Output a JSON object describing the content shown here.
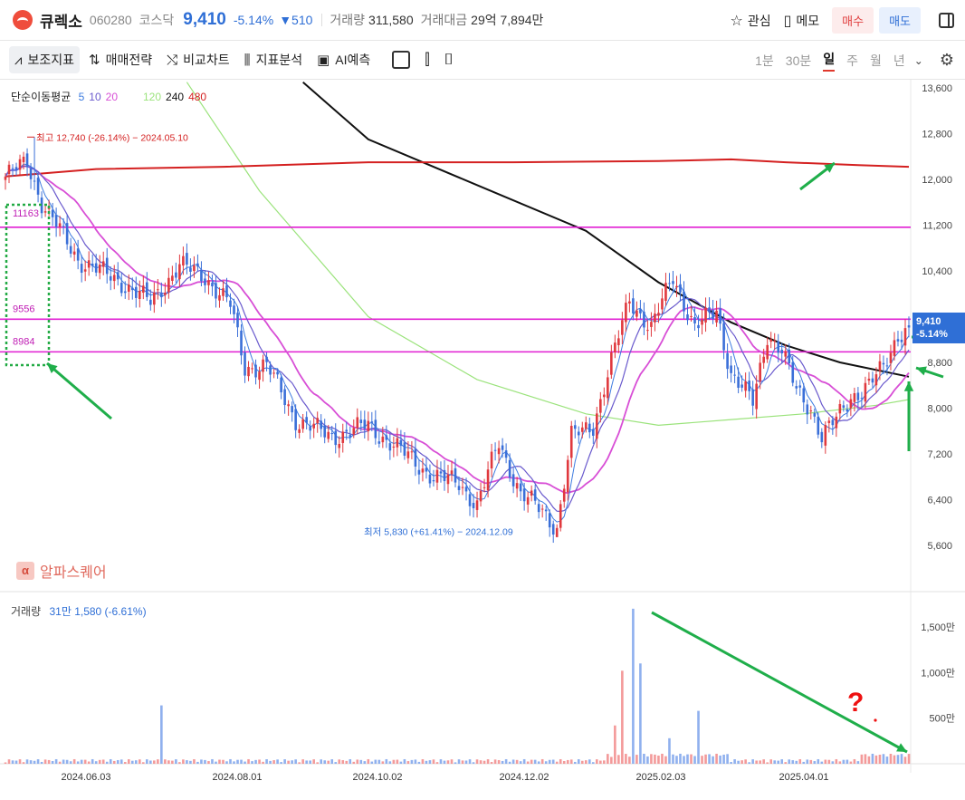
{
  "header": {
    "name": "큐렉소",
    "code": "060280",
    "market": "코스닥",
    "price": "9,410",
    "change_pct": "-5.14%",
    "change_abs": "▼510",
    "volume_label": "거래량",
    "volume": "311,580",
    "amount_label": "거래대금",
    "amount": "29억 7,894만",
    "watch": "관심",
    "memo": "메모",
    "buy": "매수",
    "sell": "매도"
  },
  "toolbar": {
    "indicators": "보조지표",
    "strategy": "매매전략",
    "compare": "비교차트",
    "analysis": "지표분석",
    "ai": "AI예측",
    "periods": [
      "1분",
      "30분",
      "일",
      "주",
      "월",
      "년"
    ],
    "selected_period": "일"
  },
  "ma_legend": {
    "label": "단순이동평균",
    "items": [
      {
        "text": "5",
        "color": "#3d7be0"
      },
      {
        "text": "10",
        "color": "#6a5acd"
      },
      {
        "text": "20",
        "color": "#d84fd6"
      },
      {
        "text": "120",
        "color": "#9be37c"
      },
      {
        "text": "240",
        "color": "#111111"
      },
      {
        "text": "480",
        "color": "#d42020"
      }
    ]
  },
  "brand": "알파스퀘어",
  "price_tag": {
    "price": "9,410",
    "pct": "-5.14%"
  },
  "volume_legend": {
    "label": "거래량",
    "value": "31만 1,580 (-6.61%)"
  },
  "annotations": {
    "high": "최고 12,740 (-26.14%) − 2024.05.10",
    "low": "최저 5,830 (+61.41%) − 2024.12.09",
    "levels": [
      "11163",
      "9556",
      "8984"
    ],
    "question": "?"
  },
  "chart_data": {
    "type": "candlestick",
    "y_axis": {
      "ticks": [
        13600,
        12800,
        12000,
        11200,
        10400,
        9600,
        8800,
        8000,
        7200,
        6400,
        5600
      ],
      "range": [
        5200,
        13900
      ]
    },
    "volume_axis": {
      "ticks": [
        "1,500만",
        "1,000만",
        "500만"
      ]
    },
    "x_labels": [
      "2024.06.03",
      "2024.08.01",
      "2024.10.02",
      "2024.12.02",
      "2025.02.03",
      "2025.04.01"
    ],
    "horizontal_levels": [
      11163,
      9556,
      8984
    ],
    "high": 12740,
    "low": 5830,
    "last": 9410,
    "anchors": [
      {
        "i": 0,
        "v": 12050
      },
      {
        "i": 6,
        "v": 12300
      },
      {
        "i": 10,
        "v": 11600
      },
      {
        "i": 20,
        "v": 10600
      },
      {
        "i": 32,
        "v": 10200
      },
      {
        "i": 40,
        "v": 9850
      },
      {
        "i": 48,
        "v": 10500
      },
      {
        "i": 55,
        "v": 10300
      },
      {
        "i": 62,
        "v": 9800
      },
      {
        "i": 66,
        "v": 8700
      },
      {
        "i": 72,
        "v": 8750
      },
      {
        "i": 80,
        "v": 7800
      },
      {
        "i": 90,
        "v": 7500
      },
      {
        "i": 100,
        "v": 7700
      },
      {
        "i": 110,
        "v": 7200
      },
      {
        "i": 118,
        "v": 6800
      },
      {
        "i": 125,
        "v": 6700
      },
      {
        "i": 130,
        "v": 6300
      },
      {
        "i": 136,
        "v": 7400
      },
      {
        "i": 142,
        "v": 6500
      },
      {
        "i": 148,
        "v": 6200
      },
      {
        "i": 152,
        "v": 5900
      },
      {
        "i": 156,
        "v": 7500
      },
      {
        "i": 162,
        "v": 7700
      },
      {
        "i": 166,
        "v": 8600
      },
      {
        "i": 172,
        "v": 9900
      },
      {
        "i": 178,
        "v": 9400
      },
      {
        "i": 184,
        "v": 10300
      },
      {
        "i": 190,
        "v": 9400
      },
      {
        "i": 196,
        "v": 9700
      },
      {
        "i": 200,
        "v": 8600
      },
      {
        "i": 206,
        "v": 8100
      },
      {
        "i": 210,
        "v": 9300
      },
      {
        "i": 214,
        "v": 9000
      },
      {
        "i": 218,
        "v": 8300
      },
      {
        "i": 222,
        "v": 8000
      },
      {
        "i": 225,
        "v": 7500
      },
      {
        "i": 229,
        "v": 7800
      },
      {
        "i": 233,
        "v": 8200
      },
      {
        "i": 238,
        "v": 8400
      },
      {
        "i": 242,
        "v": 8700
      },
      {
        "i": 246,
        "v": 9300
      },
      {
        "i": 249,
        "v": 9410
      }
    ],
    "ma_lines": {
      "ma480": [
        [
          0,
          12050
        ],
        [
          25,
          12180
        ],
        [
          60,
          12220
        ],
        [
          100,
          12300
        ],
        [
          140,
          12300
        ],
        [
          180,
          12320
        ],
        [
          200,
          12350
        ],
        [
          215,
          12300
        ],
        [
          235,
          12250
        ],
        [
          249,
          12220
        ]
      ],
      "ma240": [
        [
          82,
          13700
        ],
        [
          100,
          12700
        ],
        [
          130,
          11900
        ],
        [
          160,
          11100
        ],
        [
          180,
          10200
        ],
        [
          200,
          9500
        ],
        [
          215,
          9100
        ],
        [
          230,
          8800
        ],
        [
          249,
          8550
        ]
      ],
      "ma120": [
        [
          50,
          13700
        ],
        [
          70,
          11800
        ],
        [
          100,
          9600
        ],
        [
          130,
          8500
        ],
        [
          160,
          7900
        ],
        [
          180,
          7700
        ],
        [
          200,
          7800
        ],
        [
          220,
          7900
        ],
        [
          240,
          8050
        ],
        [
          249,
          8150
        ]
      ]
    },
    "volume_spikes": [
      {
        "i": 43,
        "v": 640
      },
      {
        "i": 170,
        "v": 1020
      },
      {
        "i": 173,
        "v": 1700
      },
      {
        "i": 175,
        "v": 1100
      },
      {
        "i": 191,
        "v": 580
      },
      {
        "i": 183,
        "v": 280
      },
      {
        "i": 168,
        "v": 420
      }
    ]
  }
}
